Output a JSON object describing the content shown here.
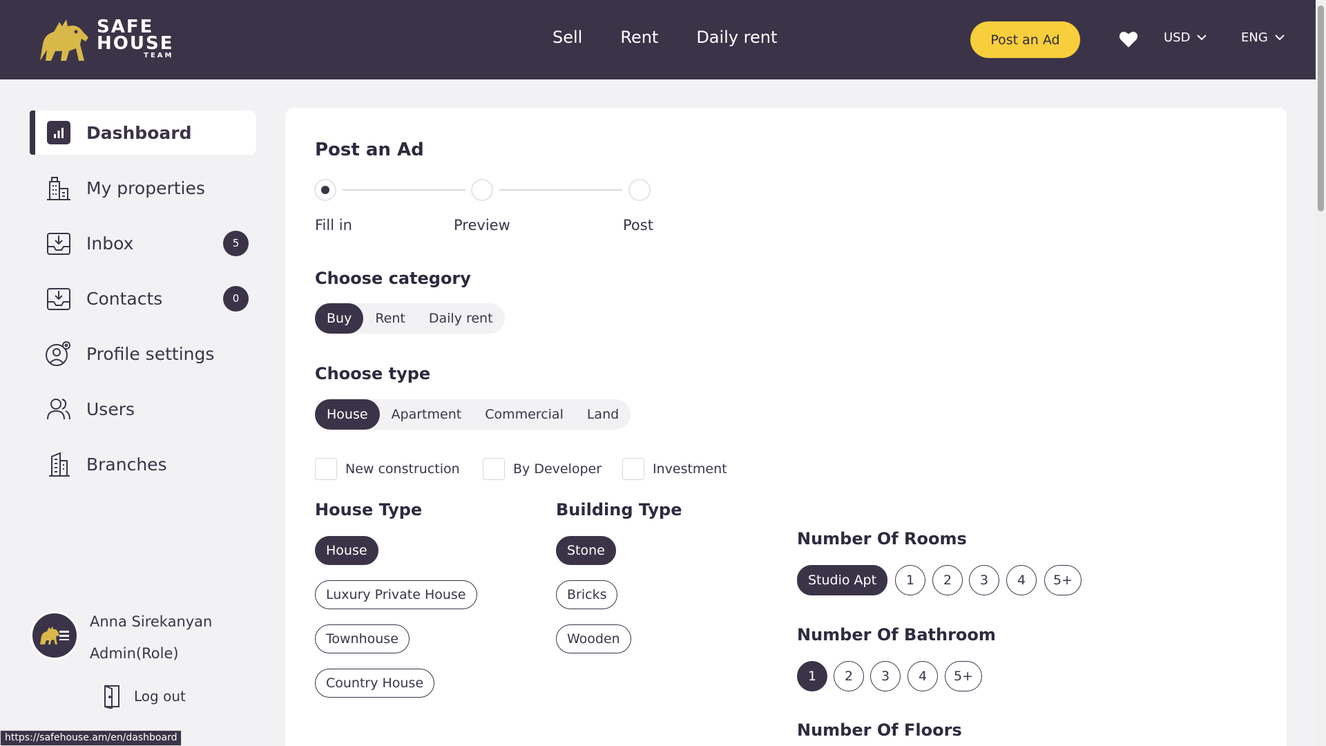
{
  "header": {
    "logo": {
      "line1": "SAFE",
      "line2": "HOUSE",
      "line3": "TEAM"
    },
    "nav": [
      "Sell",
      "Rent",
      "Daily rent"
    ],
    "post_button": "Post an Ad",
    "currency": "USD",
    "language": "ENG"
  },
  "sidebar": {
    "items": [
      {
        "label": "Dashboard",
        "icon": "dashboard-icon",
        "active": true
      },
      {
        "label": "My properties",
        "icon": "properties-icon"
      },
      {
        "label": "Inbox",
        "icon": "inbox-icon",
        "badge": "5"
      },
      {
        "label": "Contacts",
        "icon": "contacts-icon",
        "badge": "0"
      },
      {
        "label": "Profile settings",
        "icon": "profile-settings-icon"
      },
      {
        "label": "Users",
        "icon": "users-icon"
      },
      {
        "label": "Branches",
        "icon": "branches-icon"
      }
    ],
    "user": {
      "name": "Anna Sirekanyan",
      "role": "Admin(Role)"
    },
    "logout": "Log out"
  },
  "status_url": "https://safehouse.am/en/dashboard",
  "main": {
    "title": "Post an Ad",
    "steps": [
      "Fill in",
      "Preview",
      "Post"
    ],
    "category": {
      "heading": "Choose category",
      "options": [
        "Buy",
        "Rent",
        "Daily rent"
      ],
      "selected": "Buy"
    },
    "type": {
      "heading": "Choose type",
      "options": [
        "House",
        "Apartment",
        "Commercial",
        "Land"
      ],
      "selected": "House"
    },
    "checkboxes": [
      "New construction",
      "By Developer",
      "Investment"
    ],
    "house_type": {
      "heading": "House Type",
      "options": [
        "House",
        "Luxury Private House",
        "Townhouse",
        "Country House"
      ],
      "selected": "House"
    },
    "building_type": {
      "heading": "Building Type",
      "options": [
        "Stone",
        "Bricks",
        "Wooden"
      ],
      "selected": "Stone"
    },
    "rooms": {
      "heading": "Number Of Rooms",
      "options": [
        "Studio Apt",
        "1",
        "2",
        "3",
        "4",
        "5+"
      ],
      "selected": "Studio Apt"
    },
    "bathrooms": {
      "heading": "Number Of Bathroom",
      "options": [
        "1",
        "2",
        "3",
        "4",
        "5+"
      ],
      "selected": "1"
    },
    "floors": {
      "heading": "Number Of Floors"
    }
  },
  "colors": {
    "primary": "#3b3448",
    "accent": "#f7ce3c",
    "background": "#f2f2f4"
  }
}
